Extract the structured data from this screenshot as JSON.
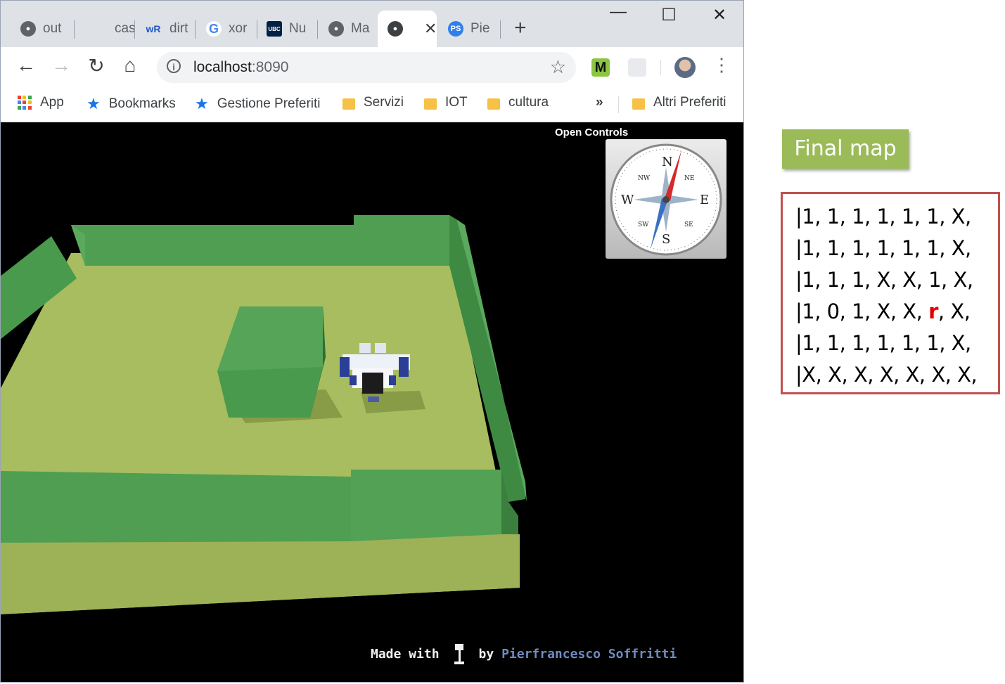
{
  "browser": {
    "tabs": [
      {
        "label": "out",
        "icon": "globe-icon"
      },
      {
        "label": "cas",
        "icon": "blank-icon"
      },
      {
        "label": "dirt",
        "icon": "wr-logo-icon"
      },
      {
        "label": "xor",
        "icon": "google-icon"
      },
      {
        "label": "Nu",
        "icon": "ubc-logo-icon"
      },
      {
        "label": "Ma",
        "icon": "globe-icon"
      },
      {
        "label": "",
        "icon": "globe-icon",
        "active": true
      },
      {
        "label": "Pie",
        "icon": "ps-avatar-icon"
      }
    ],
    "url_host": "localhost",
    "url_port": ":8090",
    "bookmarks": [
      {
        "label": "App",
        "icon": "apps-grid-icon"
      },
      {
        "label": "Bookmarks",
        "icon": "star-icon"
      },
      {
        "label": "Gestione Preferiti",
        "icon": "star-icon"
      },
      {
        "label": "Servizi",
        "icon": "folder-icon"
      },
      {
        "label": "IOT",
        "icon": "folder-icon"
      },
      {
        "label": "cultura",
        "icon": "folder-icon"
      },
      {
        "label": "»",
        "icon": "overflow-icon"
      },
      {
        "label": "Altri Preferiti",
        "icon": "folder-icon"
      }
    ]
  },
  "scene": {
    "open_controls": "Open Controls",
    "compass": {
      "n": "N",
      "s": "S",
      "e": "E",
      "w": "W",
      "ne": "NE",
      "nw": "NW",
      "se": "SE",
      "sw": "SW"
    },
    "credit": {
      "made_with": "Made with",
      "by": "by",
      "author": "Pierfrancesco Soffritti"
    },
    "colors": {
      "floor": "#a8bd5f",
      "walls": "#4f9e52",
      "background": "#000000"
    }
  },
  "annotation": {
    "final_map_label": "Final map",
    "map_rows": [
      [
        "1",
        "1",
        "1",
        "1",
        "1",
        "1",
        "X"
      ],
      [
        "1",
        "1",
        "1",
        "1",
        "1",
        "1",
        "X"
      ],
      [
        "1",
        "1",
        "1",
        "X",
        "X",
        "1",
        "X"
      ],
      [
        "1",
        "0",
        "1",
        "X",
        "X",
        "r",
        "X"
      ],
      [
        "1",
        "1",
        "1",
        "1",
        "1",
        "1",
        "X"
      ],
      [
        "X",
        "X",
        "X",
        "X",
        "X",
        "X",
        "X"
      ]
    ],
    "robot_symbol": "r",
    "robot_color": "#e00000",
    "box_border_color": "#c0504d",
    "label_color": "#9bbb59"
  }
}
